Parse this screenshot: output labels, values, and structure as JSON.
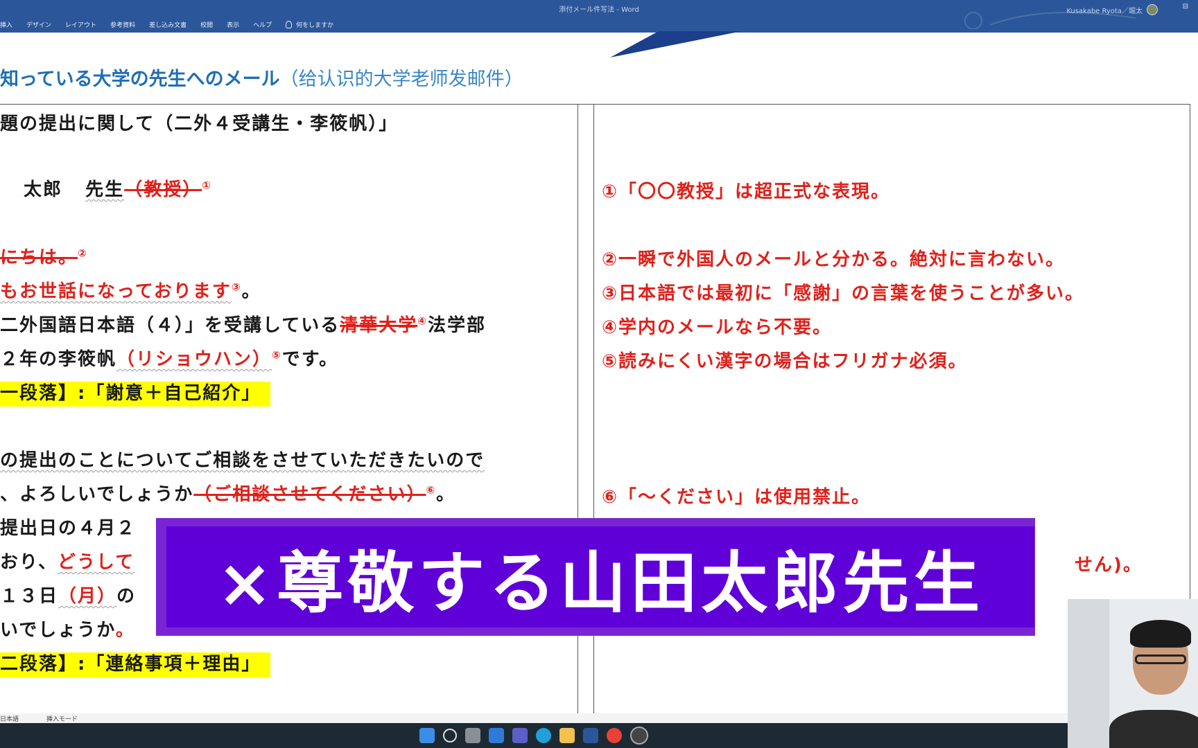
{
  "window": {
    "doc_title": "添付メール件写法 - Word",
    "account": "Kusakabe Ryota／堀太",
    "window_ctrl": "⊟"
  },
  "ribbon": {
    "tabs": [
      "挿入",
      "デザイン",
      "レイアウト",
      "参考資料",
      "差し込み文書",
      "校閲",
      "表示",
      "ヘルプ"
    ],
    "tell_me": "何をしますか"
  },
  "heading": {
    "jp": "知っている大学の先生へのメール",
    "cn": "（给认识的大学老师发邮件）"
  },
  "left": {
    "l1": "題の提出に関して（二外４受講生・李筱帆）」",
    "l2_a": "太郎",
    "l2_b": "先生",
    "l2_strike": "（教授）",
    "l2_n": "①",
    "l3_strike": "にちは。",
    "l3_n": "②",
    "l4_a": "もお世話になっております",
    "l4_n": "③",
    "l4_b": "。",
    "l5_a": "二外国語日本語（４）」を受講している",
    "l5_strike": "清華大学",
    "l5_n": "④",
    "l5_b": "法学部",
    "l6_a": "２年の李筱帆",
    "l6_red": "（リショウハン）",
    "l6_n": "⑤",
    "l6_b": "です。",
    "l7": "一段落】:「謝意＋自己紹介」",
    "l8": "の提出のことについてご相談をさせていただきたいので",
    "l9_a": "、よろしいでしょうか",
    "l9_strike": "（ご相談させてください）",
    "l9_n": "⑥",
    "l9_b": "。",
    "l10": "提出日の４月２",
    "l11_a": "おり、",
    "l11_red": "どうして",
    "l12_a": "１３日",
    "l12_red": "（月）",
    "l12_b": "の",
    "l13_a": "いでしょうか",
    "l13_b": "。",
    "l14": "二段落】:「連絡事項＋理由」"
  },
  "right": {
    "r1": "①「〇〇教授」は超正式な表現。",
    "r2": "②一瞬で外国人のメールと分かる。絶対に言わない。",
    "r3": "③日本語では最初に「感謝」の言葉を使うことが多い。",
    "r4": "④学内のメールなら不要。",
    "r5": "⑤読みにくい漢字の場合はフリガナ必須。",
    "r6": "⑥「～ください」は使用禁止。",
    "r7": "せん)。"
  },
  "caption": "×尊敬する山田太郎先生",
  "statusbar": {
    "language": "日本語",
    "mode": "挿入モード"
  },
  "colors": {
    "ribbon": "#2b579a",
    "heading": "#1f6fb5",
    "red_note": "#e0201a",
    "highlight": "#ffff00",
    "caption_bg": "#6000d8"
  }
}
